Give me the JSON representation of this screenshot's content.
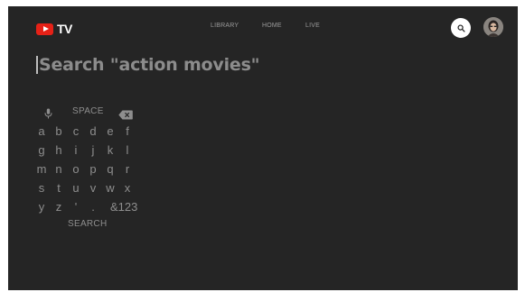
{
  "app": {
    "logo_text": "TV",
    "logo_color": "#e62117"
  },
  "nav": {
    "items": [
      {
        "label": "LIBRARY"
      },
      {
        "label": "HOME"
      },
      {
        "label": "LIVE"
      }
    ]
  },
  "header": {
    "search_icon": "search-icon",
    "avatar": "user-avatar"
  },
  "search": {
    "query": "Search \"action movies\""
  },
  "keyboard": {
    "mic_icon": "microphone-icon",
    "space_label": "SPACE",
    "backspace_icon": "backspace-icon",
    "rows": [
      [
        "a",
        "b",
        "c",
        "d",
        "e",
        "f"
      ],
      [
        "g",
        "h",
        "i",
        "j",
        "k",
        "l"
      ],
      [
        "m",
        "n",
        "o",
        "p",
        "q",
        "r"
      ],
      [
        "s",
        "t",
        "u",
        "v",
        "w",
        "x"
      ],
      [
        "y",
        "z",
        "'",
        ".",
        "&123"
      ]
    ],
    "search_label": "SEARCH"
  },
  "colors": {
    "background": "#252525",
    "text_dim": "#8e8e8e",
    "brand": "#e62117"
  }
}
